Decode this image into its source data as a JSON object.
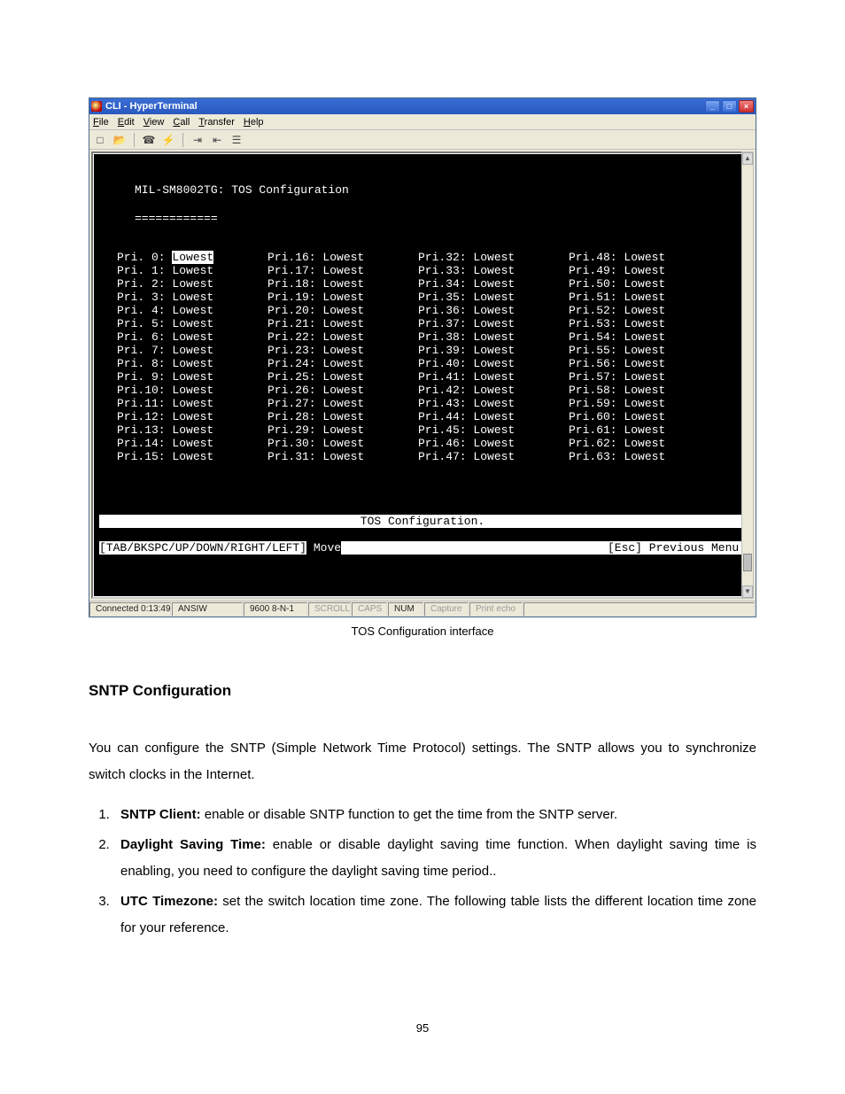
{
  "window": {
    "title": "CLI - HyperTerminal",
    "menu": [
      "File",
      "Edit",
      "View",
      "Call",
      "Transfer",
      "Help"
    ],
    "min_label": "_",
    "max_label": "□",
    "close_label": "×"
  },
  "terminal": {
    "header": "MIL-SM8002TG: TOS Configuration",
    "underline": "============",
    "columns": [
      [
        {
          "k": "Pri. 0:",
          "v": "Lowest",
          "hi": true
        },
        {
          "k": "Pri. 1:",
          "v": "Lowest"
        },
        {
          "k": "Pri. 2:",
          "v": "Lowest"
        },
        {
          "k": "Pri. 3:",
          "v": "Lowest"
        },
        {
          "k": "Pri. 4:",
          "v": "Lowest"
        },
        {
          "k": "Pri. 5:",
          "v": "Lowest"
        },
        {
          "k": "Pri. 6:",
          "v": "Lowest"
        },
        {
          "k": "Pri. 7:",
          "v": "Lowest"
        },
        {
          "k": "Pri. 8:",
          "v": "Lowest"
        },
        {
          "k": "Pri. 9:",
          "v": "Lowest"
        },
        {
          "k": "Pri.10:",
          "v": "Lowest"
        },
        {
          "k": "Pri.11:",
          "v": "Lowest"
        },
        {
          "k": "Pri.12:",
          "v": "Lowest"
        },
        {
          "k": "Pri.13:",
          "v": "Lowest"
        },
        {
          "k": "Pri.14:",
          "v": "Lowest"
        },
        {
          "k": "Pri.15:",
          "v": "Lowest"
        }
      ],
      [
        {
          "k": "Pri.16:",
          "v": "Lowest"
        },
        {
          "k": "Pri.17:",
          "v": "Lowest"
        },
        {
          "k": "Pri.18:",
          "v": "Lowest"
        },
        {
          "k": "Pri.19:",
          "v": "Lowest"
        },
        {
          "k": "Pri.20:",
          "v": "Lowest"
        },
        {
          "k": "Pri.21:",
          "v": "Lowest"
        },
        {
          "k": "Pri.22:",
          "v": "Lowest"
        },
        {
          "k": "Pri.23:",
          "v": "Lowest"
        },
        {
          "k": "Pri.24:",
          "v": "Lowest"
        },
        {
          "k": "Pri.25:",
          "v": "Lowest"
        },
        {
          "k": "Pri.26:",
          "v": "Lowest"
        },
        {
          "k": "Pri.27:",
          "v": "Lowest"
        },
        {
          "k": "Pri.28:",
          "v": "Lowest"
        },
        {
          "k": "Pri.29:",
          "v": "Lowest"
        },
        {
          "k": "Pri.30:",
          "v": "Lowest"
        },
        {
          "k": "Pri.31:",
          "v": "Lowest"
        }
      ],
      [
        {
          "k": "Pri.32:",
          "v": "Lowest"
        },
        {
          "k": "Pri.33:",
          "v": "Lowest"
        },
        {
          "k": "Pri.34:",
          "v": "Lowest"
        },
        {
          "k": "Pri.35:",
          "v": "Lowest"
        },
        {
          "k": "Pri.36:",
          "v": "Lowest"
        },
        {
          "k": "Pri.37:",
          "v": "Lowest"
        },
        {
          "k": "Pri.38:",
          "v": "Lowest"
        },
        {
          "k": "Pri.39:",
          "v": "Lowest"
        },
        {
          "k": "Pri.40:",
          "v": "Lowest"
        },
        {
          "k": "Pri.41:",
          "v": "Lowest"
        },
        {
          "k": "Pri.42:",
          "v": "Lowest"
        },
        {
          "k": "Pri.43:",
          "v": "Lowest"
        },
        {
          "k": "Pri.44:",
          "v": "Lowest"
        },
        {
          "k": "Pri.45:",
          "v": "Lowest"
        },
        {
          "k": "Pri.46:",
          "v": "Lowest"
        },
        {
          "k": "Pri.47:",
          "v": "Lowest"
        }
      ],
      [
        {
          "k": "Pri.48:",
          "v": "Lowest"
        },
        {
          "k": "Pri.49:",
          "v": "Lowest"
        },
        {
          "k": "Pri.50:",
          "v": "Lowest"
        },
        {
          "k": "Pri.51:",
          "v": "Lowest"
        },
        {
          "k": "Pri.52:",
          "v": "Lowest"
        },
        {
          "k": "Pri.53:",
          "v": "Lowest"
        },
        {
          "k": "Pri.54:",
          "v": "Lowest"
        },
        {
          "k": "Pri.55:",
          "v": "Lowest"
        },
        {
          "k": "Pri.56:",
          "v": "Lowest"
        },
        {
          "k": "Pri.57:",
          "v": "Lowest"
        },
        {
          "k": "Pri.58:",
          "v": "Lowest"
        },
        {
          "k": "Pri.59:",
          "v": "Lowest"
        },
        {
          "k": "Pri.60:",
          "v": "Lowest"
        },
        {
          "k": "Pri.61:",
          "v": "Lowest"
        },
        {
          "k": "Pri.62:",
          "v": "Lowest"
        },
        {
          "k": "Pri.63:",
          "v": "Lowest"
        }
      ]
    ],
    "footer_title": "TOS Configuration.",
    "nav_left": "[TAB/BKSPC/UP/DOWN/RIGHT/LEFT]",
    "nav_mid": " Move",
    "nav_right": "[Esc] Previous Menu "
  },
  "status": {
    "connected": "Connected 0:13:49",
    "emul": "ANSIW",
    "port": "9600 8-N-1",
    "scroll": "SCROLL",
    "caps": "CAPS",
    "num": "NUM",
    "capture": "Capture",
    "printecho": "Print echo"
  },
  "caption": "TOS Configuration interface",
  "heading": "SNTP Configuration",
  "para1": "You can configure the SNTP (Simple Network Time Protocol) settings. The SNTP allows you to synchronize switch clocks in the Internet.",
  "list": [
    {
      "b": "SNTP Client:",
      "t": " enable or disable SNTP function to get the time from the SNTP server."
    },
    {
      "b": "Daylight Saving Time:",
      "t": " enable or disable daylight saving time function. When daylight saving time is enabling, you need to configure the daylight saving time period.."
    },
    {
      "b": "UTC Timezone:",
      "t": " set the switch location time zone. The following table lists the different location time zone for your reference."
    }
  ],
  "pagenum": "95"
}
